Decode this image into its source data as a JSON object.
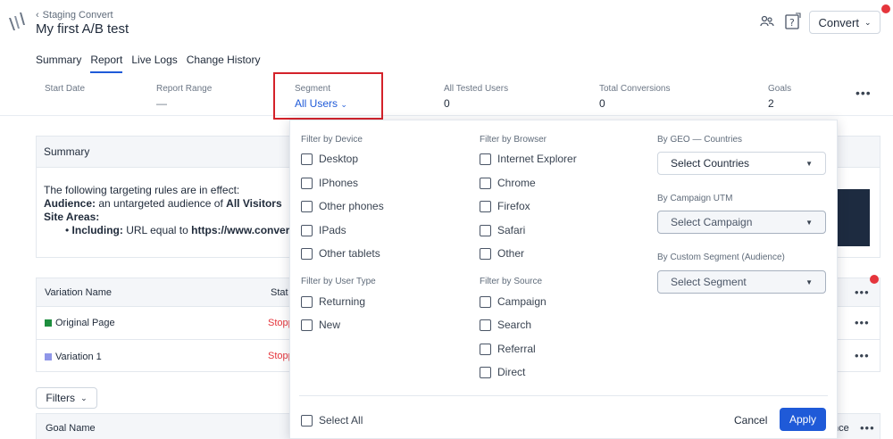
{
  "header": {
    "breadcrumb": "Staging Convert",
    "title": "My first A/B test",
    "convert_button": "Convert",
    "users_icon": "users-icon",
    "help_icon": "help-icon"
  },
  "tabs": [
    {
      "label": "Summary"
    },
    {
      "label": "Report"
    },
    {
      "label": "Live Logs"
    },
    {
      "label": "Change History"
    }
  ],
  "stats": {
    "start_date": {
      "label": "Start Date",
      "value": ""
    },
    "report_range": {
      "label": "Report Range",
      "value": "—"
    },
    "segment": {
      "label": "Segment",
      "value": "All Users"
    },
    "all_tested_users": {
      "label": "All Tested Users",
      "value": "0"
    },
    "total_conversions": {
      "label": "Total Conversions",
      "value": "0"
    },
    "goals": {
      "label": "Goals",
      "value": "2"
    }
  },
  "summary": {
    "heading": "Summary",
    "intro": "The following targeting rules are in effect:",
    "audience_label": "Audience:",
    "audience_text": "an untargeted audience of",
    "audience_value": "All Visitors",
    "site_areas_label": "Site Areas:",
    "including_label": "Including:",
    "including_text": "URL equal to",
    "including_value": "https://www.convert.cor"
  },
  "variations": {
    "col_name": "Variation Name",
    "col_status": "Stat",
    "rows": [
      {
        "name": "Original Page",
        "status": "Stopp",
        "color": "#1e8e3e"
      },
      {
        "name": "Variation 1",
        "status": "Stopp",
        "color": "#8f96e8"
      }
    ]
  },
  "filters_button": "Filters",
  "goals_table": {
    "col_name": "Goal Name",
    "col_right": "nce"
  },
  "dropdown": {
    "device": {
      "title": "Filter by Device",
      "options": [
        "Desktop",
        "IPhones",
        "Other phones",
        "IPads",
        "Other tablets"
      ]
    },
    "user_type": {
      "title": "Filter by User Type",
      "options": [
        "Returning",
        "New"
      ]
    },
    "browser": {
      "title": "Filter by Browser",
      "options": [
        "Internet Explorer",
        "Chrome",
        "Firefox",
        "Safari",
        "Other"
      ]
    },
    "source": {
      "title": "Filter by Source",
      "options": [
        "Campaign",
        "Search",
        "Referral",
        "Direct"
      ]
    },
    "geo": {
      "title": "By GEO — Countries",
      "placeholder": "Select Countries"
    },
    "campaign": {
      "title": "By Campaign UTM",
      "placeholder": "Select Campaign"
    },
    "custom_segment": {
      "title": "By Custom Segment (Audience)",
      "placeholder": "Select Segment"
    },
    "select_all": "Select All",
    "cancel": "Cancel",
    "apply": "Apply"
  },
  "colors": {
    "accent": "#1f5ad8",
    "alert": "#e5353c",
    "highlight_border": "#d4222a"
  }
}
